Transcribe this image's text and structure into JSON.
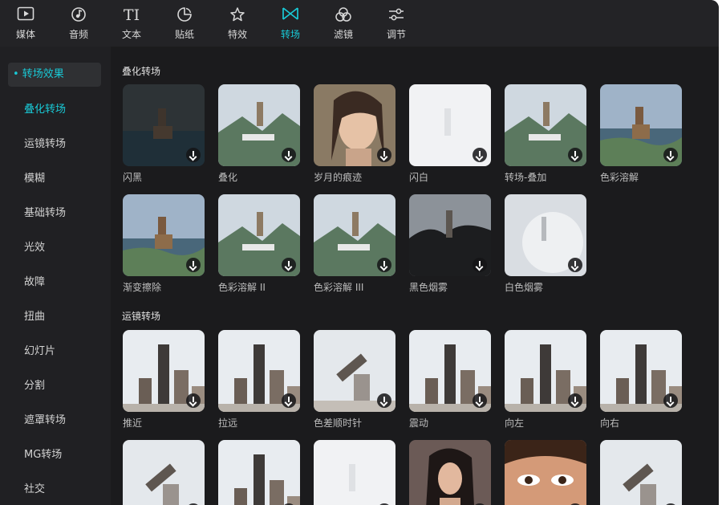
{
  "toolbar": {
    "items": [
      {
        "label": "媒体",
        "icon": "▶"
      },
      {
        "label": "音频",
        "icon": "♪"
      },
      {
        "label": "文本",
        "icon": "TI"
      },
      {
        "label": "贴纸",
        "icon": "◔"
      },
      {
        "label": "特效",
        "icon": "☆"
      },
      {
        "label": "转场",
        "icon": "⋈"
      },
      {
        "label": "滤镜",
        "icon": "☘"
      },
      {
        "label": "调节",
        "icon": "⚙"
      }
    ],
    "active": "转场",
    "accent_color": "#19c9d6"
  },
  "sidebar": {
    "header": "• 转场效果",
    "items": [
      "叠化转场",
      "运镜转场",
      "模糊",
      "基础转场",
      "光效",
      "故障",
      "扭曲",
      "幻灯片",
      "分割",
      "遮罩转场",
      "MG转场",
      "社交"
    ],
    "active": "叠化转场"
  },
  "sections": [
    {
      "title": "叠化转场",
      "items": [
        "闪黑",
        "叠化",
        "岁月的痕迹",
        "闪白",
        "转场-叠加",
        "色彩溶解",
        "渐变擦除",
        "色彩溶解 II",
        "色彩溶解 III",
        "黑色烟雾",
        "白色烟雾"
      ]
    },
    {
      "title": "运镜转场",
      "items": [
        "推近",
        "拉远",
        "色差顺时针",
        "震动",
        "向左",
        "向右",
        "",
        "",
        "",
        "",
        "",
        ""
      ]
    }
  ]
}
